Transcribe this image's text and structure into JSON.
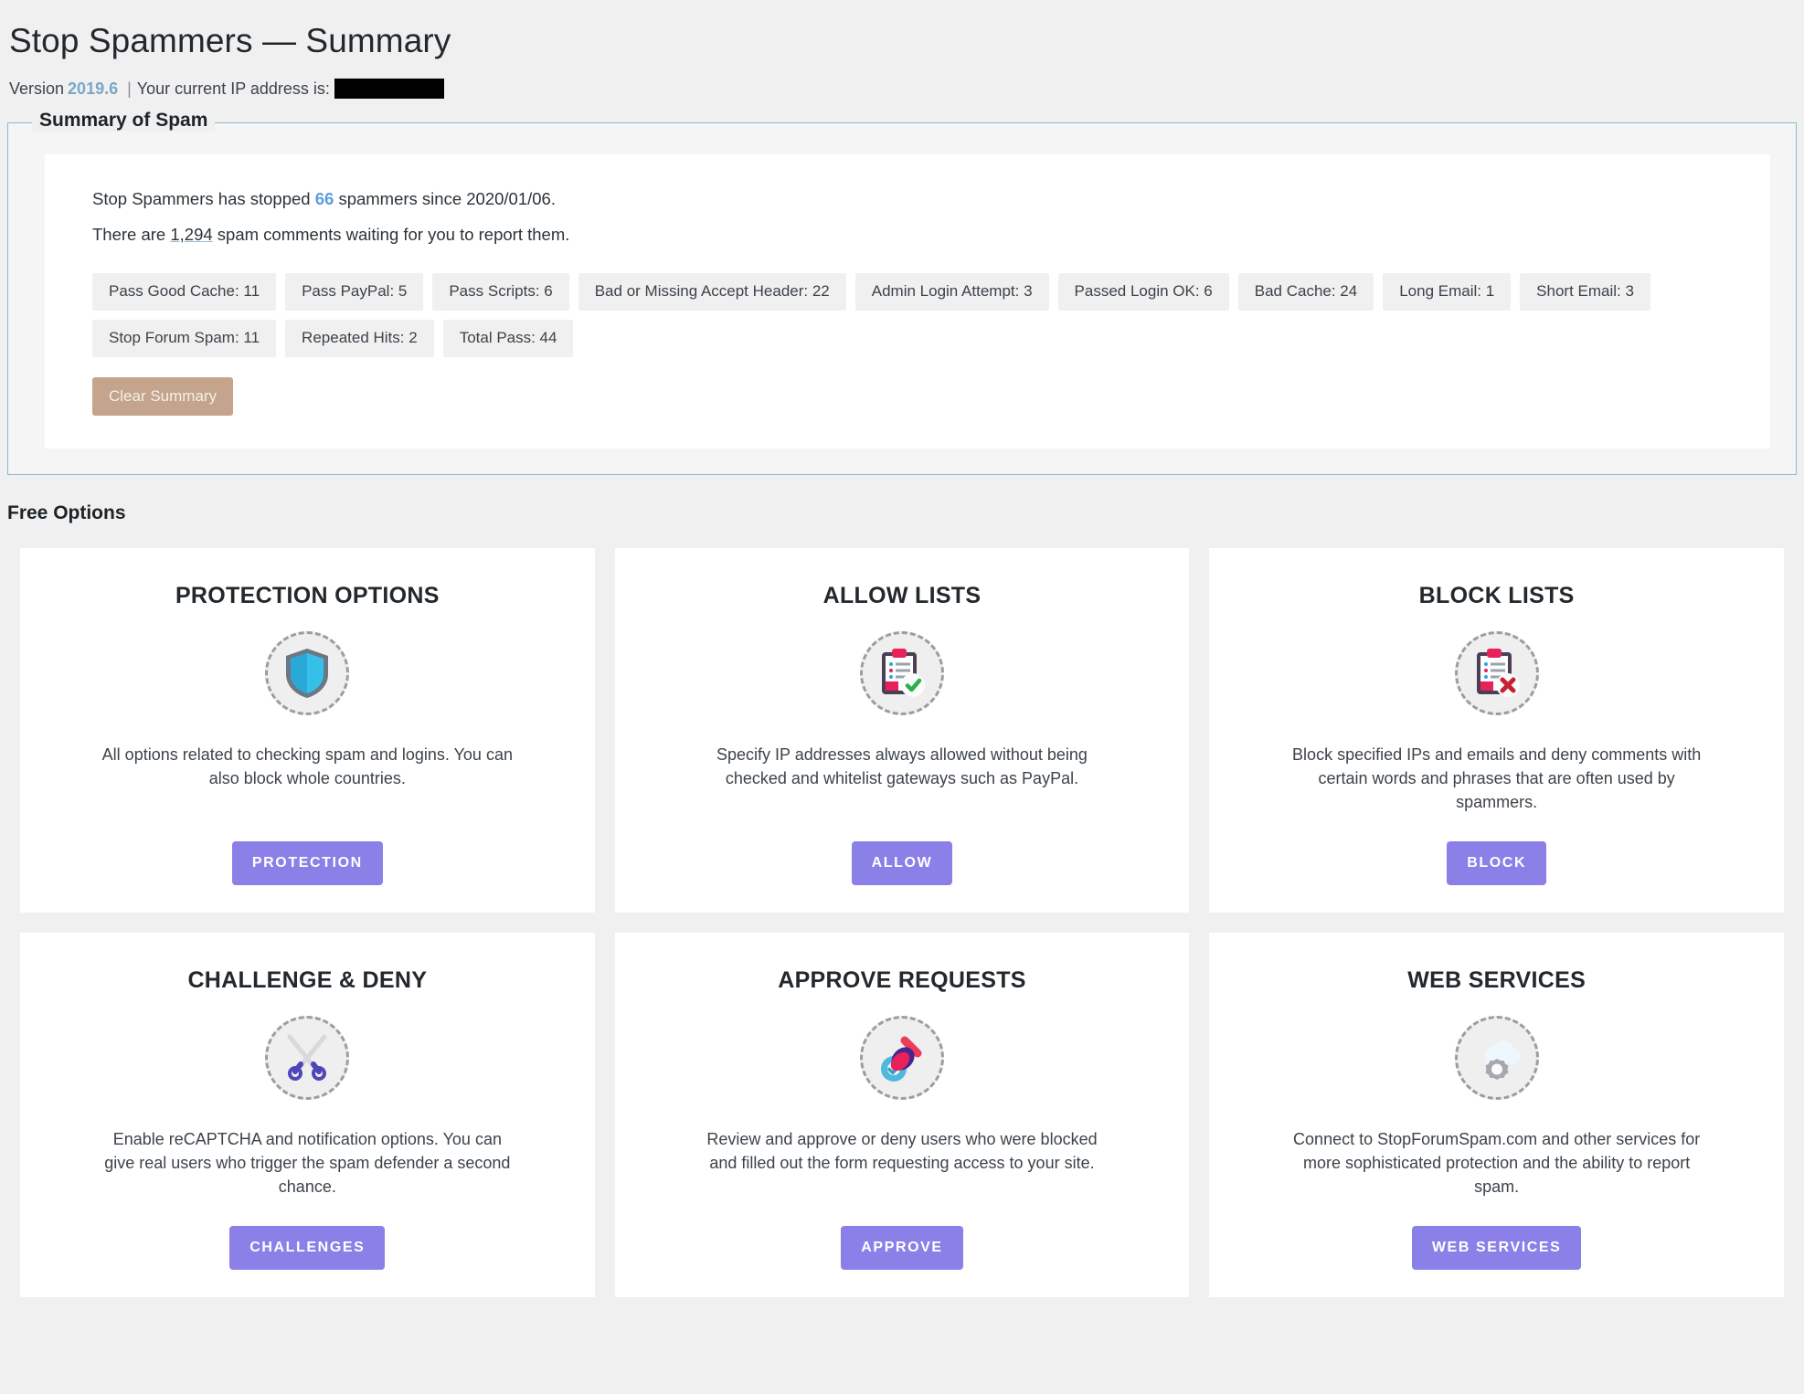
{
  "header": {
    "title": "Stop Spammers — Summary",
    "version_label": "Version",
    "version_number": "2019.6",
    "separator": "|",
    "ip_label": "Your current IP address is:",
    "ip_value_redacted": true
  },
  "summary": {
    "legend": "Summary of Spam",
    "line1_prefix": "Stop Spammers has stopped",
    "line1_count": "66",
    "line1_suffix": "spammers since 2020/01/06.",
    "line2_prefix": "There are",
    "line2_count": "1,294",
    "line2_suffix": "spam comments waiting for you to report them.",
    "clear_button": "Clear Summary",
    "chips": [
      "Pass Good Cache: 11",
      "Pass PayPal: 5",
      "Pass Scripts: 6",
      "Bad or Missing Accept Header: 22",
      "Admin Login Attempt: 3",
      "Passed Login OK: 6",
      "Bad Cache: 24",
      "Long Email: 1",
      "Short Email: 3",
      "Stop Forum Spam: 11",
      "Repeated Hits: 2",
      "Total Pass: 44"
    ]
  },
  "free_options": {
    "section_title": "Free Options",
    "cards": [
      {
        "title": "PROTECTION OPTIONS",
        "icon": "shield-icon",
        "desc": "All options related to checking spam and logins. You can also block whole countries.",
        "button": "PROTECTION"
      },
      {
        "title": "ALLOW LISTS",
        "icon": "clipboard-check-icon",
        "desc": "Specify IP addresses always allowed without being checked and whitelist gateways such as PayPal.",
        "button": "ALLOW"
      },
      {
        "title": "BLOCK LISTS",
        "icon": "clipboard-x-icon",
        "desc": "Block specified IPs and emails and deny comments with certain words and phrases that are often used by spammers.",
        "button": "BLOCK"
      },
      {
        "title": "CHALLENGE & DENY",
        "icon": "crossed-swords-icon",
        "desc": "Enable reCAPTCHA and notification options. You can give real users who trigger the spam defender a second chance.",
        "button": "CHALLENGES"
      },
      {
        "title": "APPROVE REQUESTS",
        "icon": "stamp-approve-icon",
        "desc": "Review and approve or deny users who were blocked and filled out the form requesting access to your site.",
        "button": "APPROVE"
      },
      {
        "title": "WEB SERVICES",
        "icon": "cloud-gear-icon",
        "desc": "Connect to StopForumSpam.com and other services for more sophisticated protection and the ability to report spam.",
        "button": "WEB SERVICES"
      }
    ]
  },
  "colors": {
    "accent_purple": "#8b7fe8",
    "link_blue": "#5b9dd9",
    "clear_button": "#c4a48c",
    "fieldset_border": "#8bb8cf",
    "page_bg": "#f0f0f1"
  }
}
